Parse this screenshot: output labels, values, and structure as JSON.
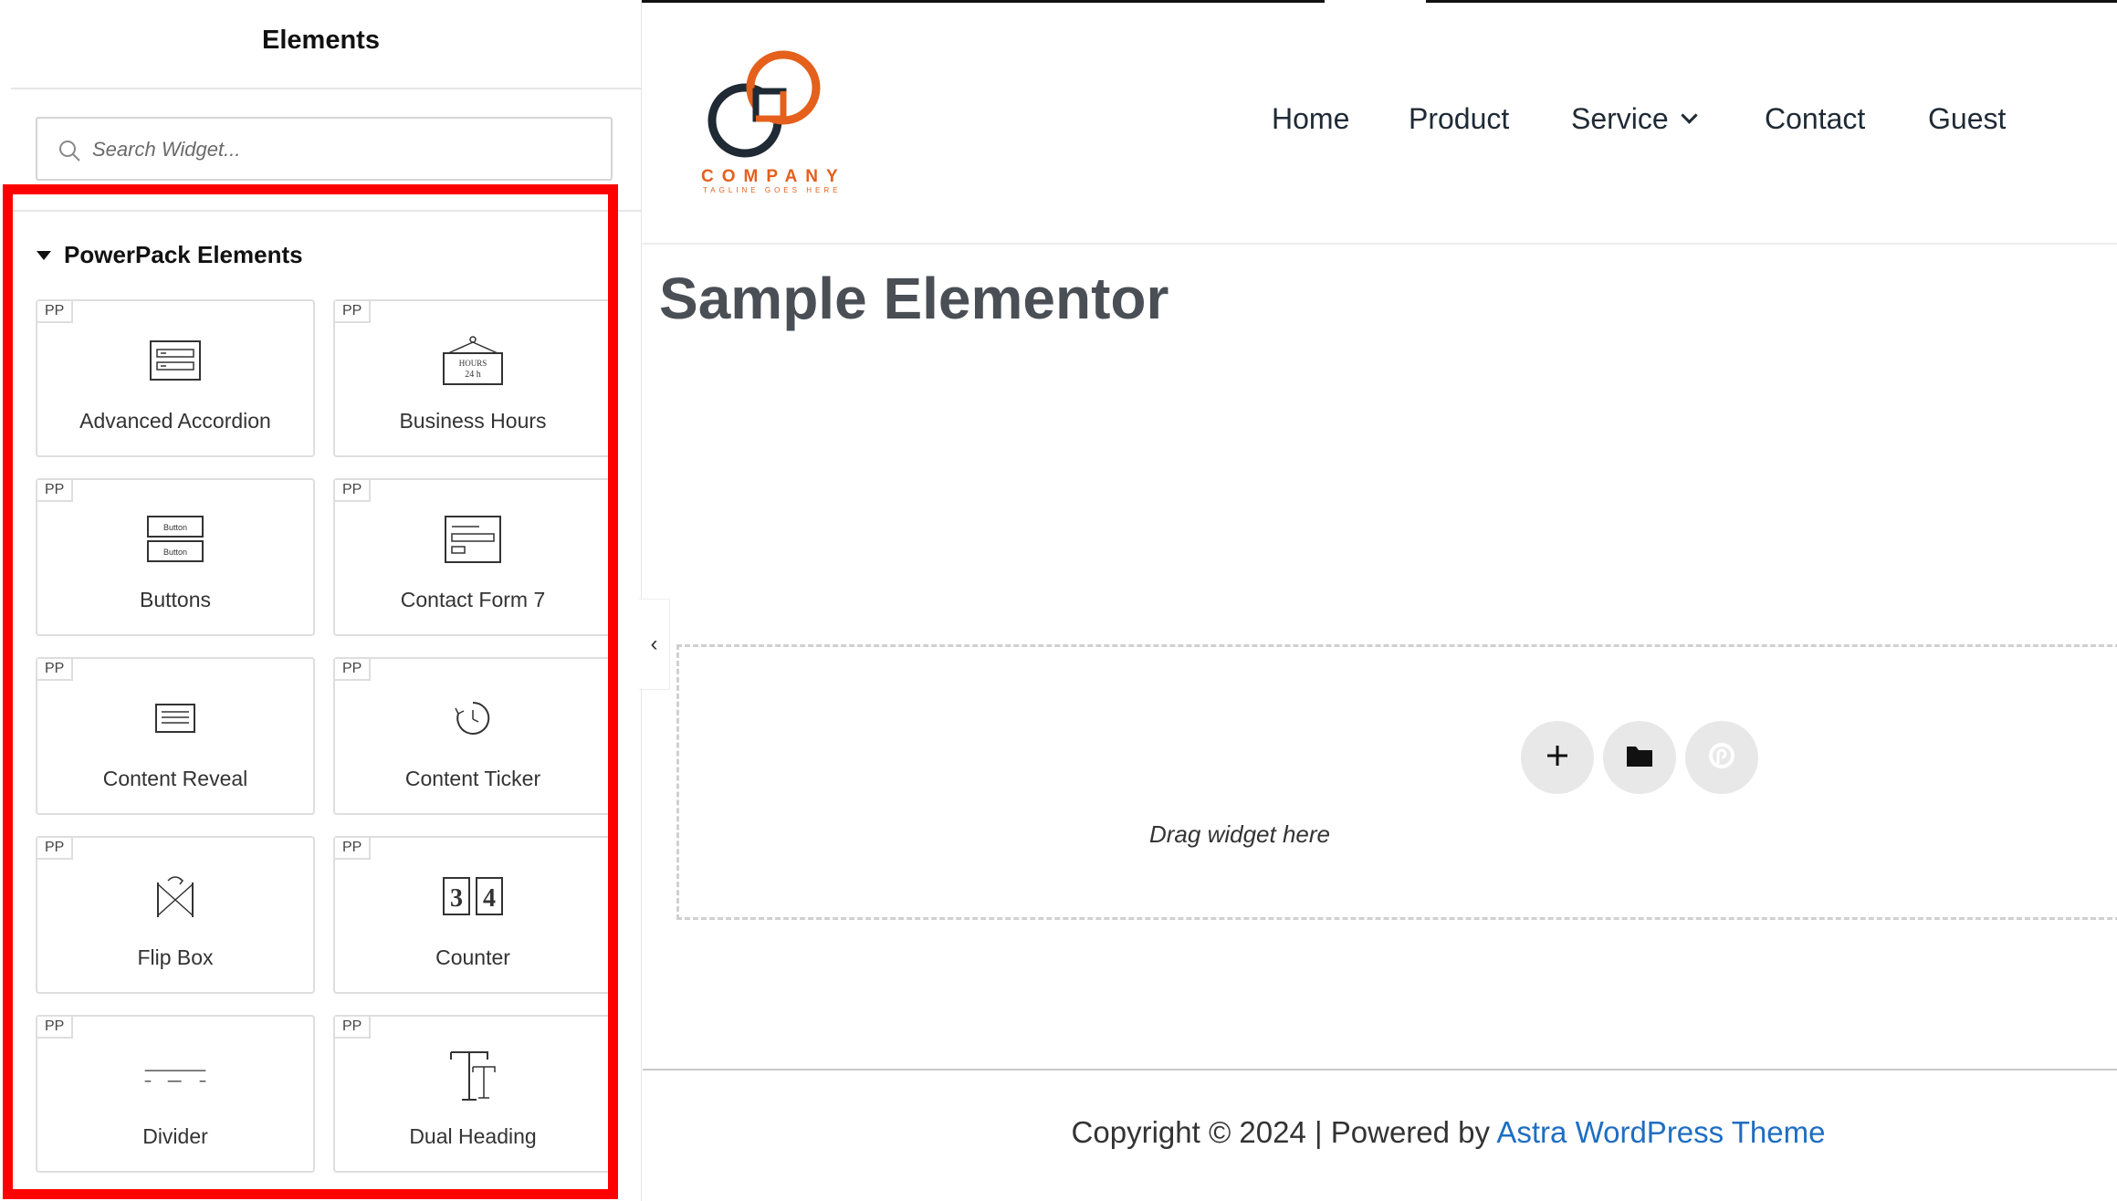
{
  "panel": {
    "title": "Elements",
    "search_placeholder": "Search Widget...",
    "section_title": "PowerPack Elements",
    "badge": "PP",
    "widgets": [
      {
        "label": "Advanced Accordion",
        "icon": "accordion-icon"
      },
      {
        "label": "Business Hours",
        "icon": "hours-sign-icon"
      },
      {
        "label": "Buttons",
        "icon": "buttons-icon"
      },
      {
        "label": "Contact Form 7",
        "icon": "form-icon"
      },
      {
        "label": "Content Reveal",
        "icon": "content-reveal-icon"
      },
      {
        "label": "Content Ticker",
        "icon": "ticker-icon"
      },
      {
        "label": "Flip Box",
        "icon": "flip-box-icon"
      },
      {
        "label": "Counter",
        "icon": "counter-icon"
      },
      {
        "label": "Divider",
        "icon": "divider-icon"
      },
      {
        "label": "Dual Heading",
        "icon": "dual-heading-icon"
      }
    ],
    "icon_texts": {
      "hours_line1": "HOURS",
      "hours_line2": "24 h",
      "button_1": "Button",
      "button_2": "Button",
      "counter_1": "3",
      "counter_2": "4"
    }
  },
  "site": {
    "logo_text": "COMPANY",
    "logo_tagline": "TAGLINE GOES HERE",
    "nav": [
      "Home",
      "Product",
      "Service",
      "Contact",
      "Guest"
    ],
    "page_title": "Sample Elementor",
    "drop_text": "Drag widget here",
    "footer_text": "Copyright © 2024 | Powered by ",
    "footer_link": "Astra WordPress Theme"
  },
  "colors": {
    "highlight": "#ff0000",
    "logo_orange": "#e4601c",
    "logo_navy": "#1f2a35",
    "link_blue": "#1f6ec2"
  }
}
